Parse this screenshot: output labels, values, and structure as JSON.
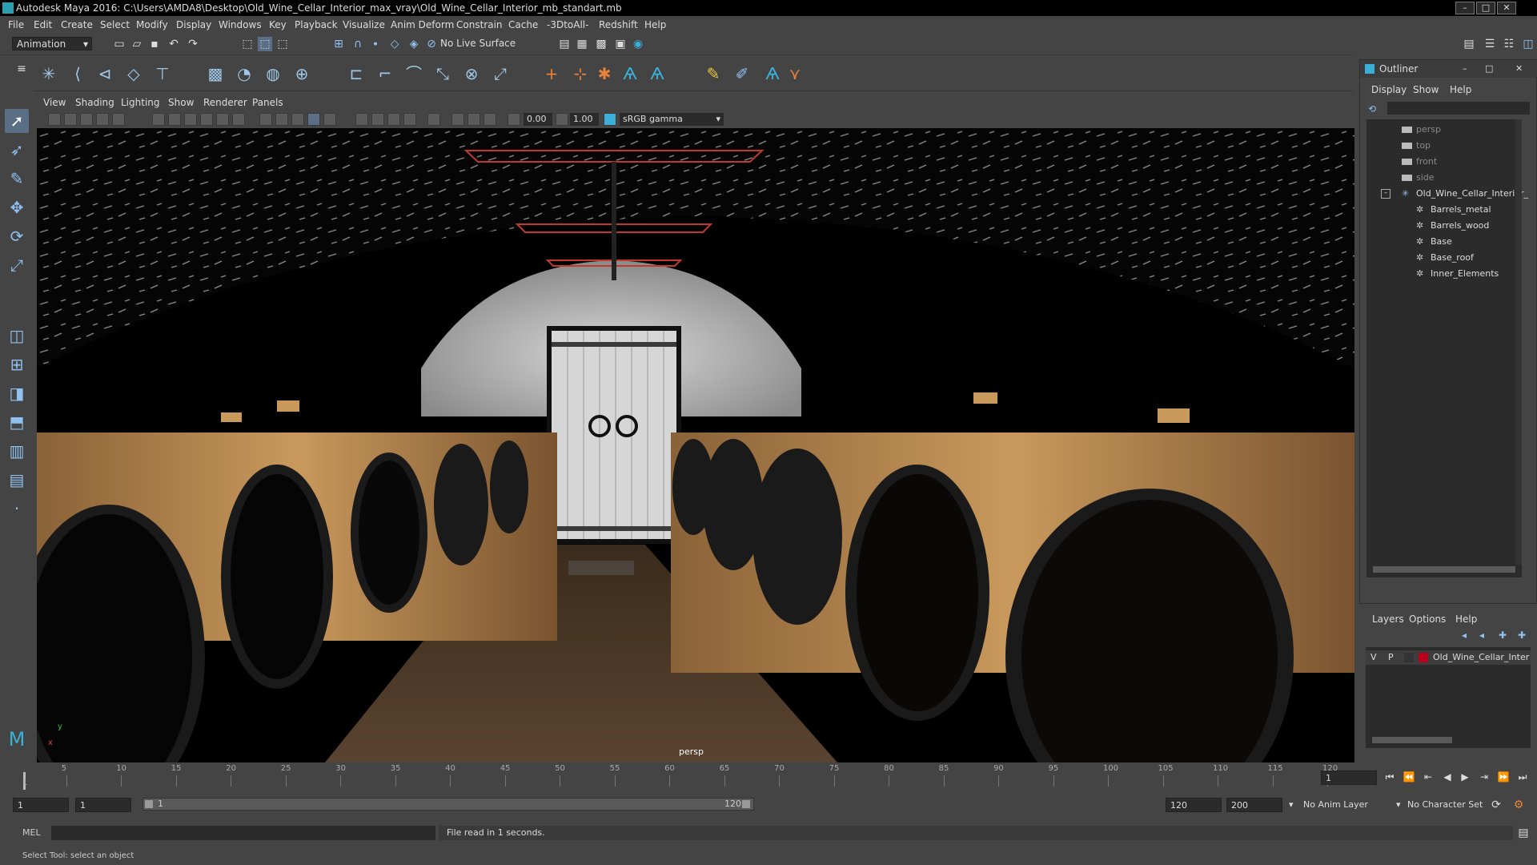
{
  "window": {
    "title": "Autodesk Maya 2016: C:\\Users\\AMDA8\\Desktop\\Old_Wine_Cellar_Interior_max_vray\\Old_Wine_Cellar_Interior_mb_standart.mb",
    "minimize": "–",
    "maximize": "□",
    "close": "✕"
  },
  "menubar": [
    "File",
    "Edit",
    "Create",
    "Select",
    "Modify",
    "Display",
    "Windows",
    "Key",
    "Playback",
    "Visualize",
    "Anim Deform",
    "Constrain",
    "Cache",
    "-3DtoAll-",
    "Redshift",
    "Help"
  ],
  "statusline": {
    "mode": "Animation",
    "live_surface": "No Live Surface"
  },
  "viewport": {
    "menus": [
      "View",
      "Shading",
      "Lighting",
      "Show",
      "Renderer",
      "Panels"
    ],
    "near_value": "0.00",
    "far_value": "1.00",
    "color_space": "sRGB gamma",
    "camera_label": "persp"
  },
  "outliner": {
    "title": "Outliner",
    "menus": [
      "Display",
      "Show",
      "Help"
    ],
    "cameras": [
      "persp",
      "top",
      "front",
      "side"
    ],
    "root": "Old_Wine_Cellar_Interior_",
    "children": [
      "Barrels_metal",
      "Barrels_wood",
      "Base",
      "Base_roof",
      "Inner_Elements"
    ]
  },
  "layers": {
    "menus": [
      "Layers",
      "Options",
      "Help"
    ],
    "rows": [
      {
        "v": "V",
        "p": "P",
        "name": "Old_Wine_Cellar_Inter",
        "color": "#b8001e"
      }
    ]
  },
  "timeline": {
    "ticks": [
      "5",
      "10",
      "15",
      "20",
      "25",
      "30",
      "35",
      "40",
      "45",
      "50",
      "55",
      "60",
      "65",
      "70",
      "75",
      "80",
      "85",
      "90",
      "95",
      "100",
      "105",
      "110",
      "115",
      "120"
    ],
    "start_label": "1",
    "current_frame": "1"
  },
  "range": {
    "start": "1",
    "playback_start": "1",
    "slider_start": "1",
    "slider_end": "120",
    "playback_end": "120",
    "end": "200",
    "anim_layer": "No Anim Layer",
    "character_set": "No Character Set"
  },
  "command_line": {
    "language": "MEL",
    "result": "File read in  1 seconds."
  },
  "help_line": "Select Tool: select an object",
  "colors": {
    "ui_bg": "#444444",
    "field_bg": "#2b2b2b",
    "layer_color": "#b8001e",
    "select_highlight": "#5a6e86"
  }
}
